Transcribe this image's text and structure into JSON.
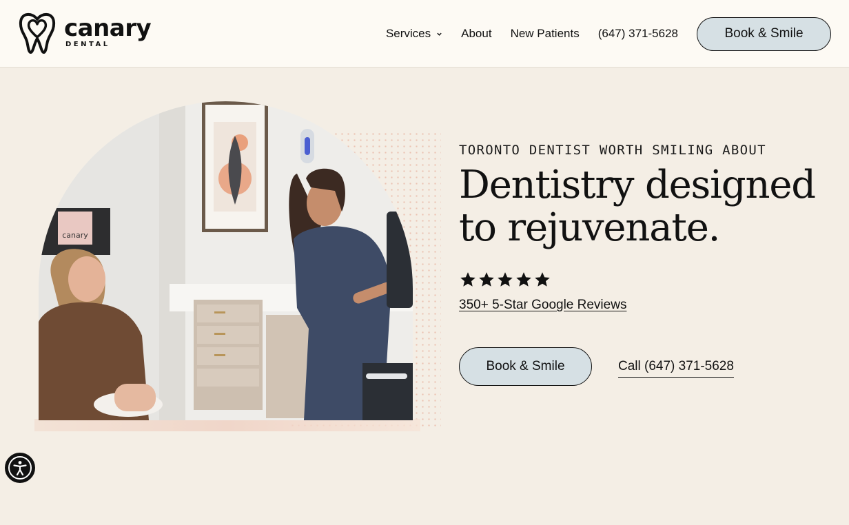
{
  "brand": {
    "name": "canary",
    "subtitle": "DENTAL"
  },
  "nav": {
    "services": "Services",
    "about": "About",
    "new_patients": "New Patients",
    "phone": "(647) 371-5628",
    "book": "Book & Smile"
  },
  "hero": {
    "eyebrow": "TORONTO DENTIST WORTH SMILING ABOUT",
    "headline": "Dentistry designed to rejuvenate.",
    "rating_stars": 5,
    "reviews_link": "350+ 5-Star Google Reviews",
    "book_button": "Book & Smile",
    "call_link": "Call (647) 371-5628",
    "image_sign_text": "canary"
  },
  "colors": {
    "page_bg": "#f4eee5",
    "header_bg": "#fdfaf4",
    "button_bg": "#d6e0e4",
    "text": "#111111",
    "accent_dots": "#e8b39f"
  },
  "icons": {
    "services_chevron": "chevron-down-icon",
    "star": "star-icon",
    "accessibility": "accessibility-icon",
    "logo_mark": "tooth-heart-icon"
  }
}
